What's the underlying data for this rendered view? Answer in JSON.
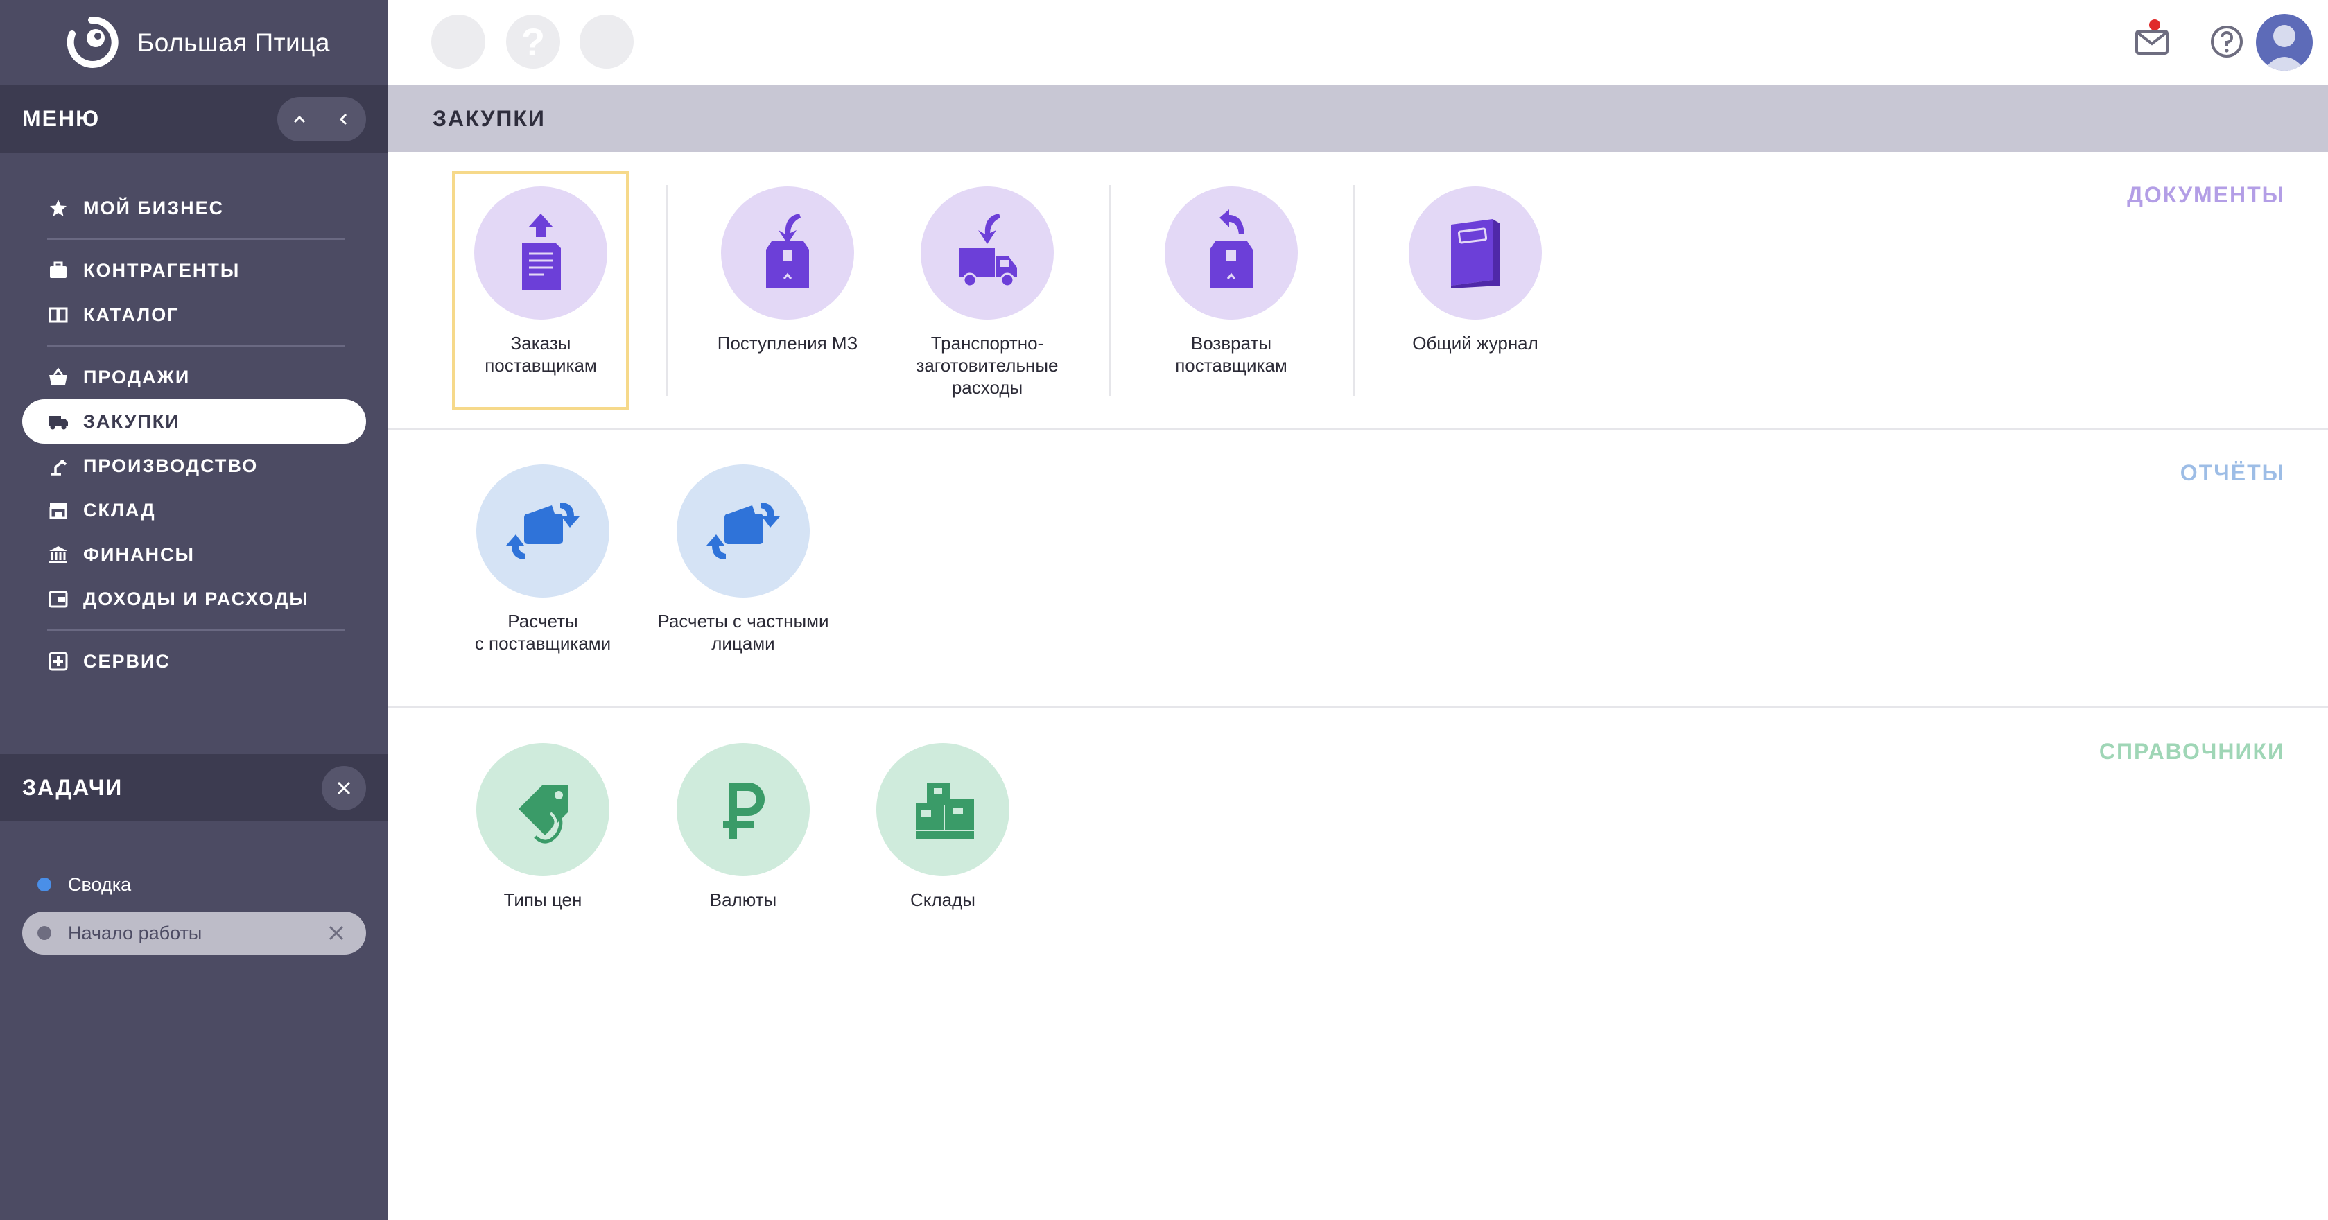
{
  "app": {
    "brand": "Большая Птица"
  },
  "sidebar": {
    "menu_title": "МЕНЮ",
    "items": [
      {
        "label": "МОЙ БИЗНЕС",
        "icon": "star-icon"
      },
      {
        "label": "КОНТРАГЕНТЫ",
        "icon": "briefcase-icon"
      },
      {
        "label": "КАТАЛОГ",
        "icon": "book-icon"
      },
      {
        "label": "ПРОДАЖИ",
        "icon": "basket-icon"
      },
      {
        "label": "ЗАКУПКИ",
        "icon": "truck-icon",
        "active": true
      },
      {
        "label": "ПРОИЗВОДСТВО",
        "icon": "robot-arm-icon"
      },
      {
        "label": "СКЛАД",
        "icon": "warehouse-icon"
      },
      {
        "label": "ФИНАНСЫ",
        "icon": "bank-icon"
      },
      {
        "label": "ДОХОДЫ И РАСХОДЫ",
        "icon": "wallet-icon"
      },
      {
        "label": "СЕРВИС",
        "icon": "service-icon"
      }
    ],
    "tasks_title": "ЗАДАЧИ",
    "tasks": [
      {
        "label": "Сводка",
        "dot_color": "#4a8fe8"
      },
      {
        "label": "Начало работы",
        "dot_color": "#6e6d80",
        "active": true
      }
    ]
  },
  "page": {
    "title": "ЗАКУПКИ"
  },
  "sections": {
    "documents": {
      "title": "ДОКУМЕНТЫ",
      "color": "#b39ee6",
      "tiles": [
        {
          "label": "Заказы\nпоставщикам",
          "icon": "order-doc-icon"
        },
        {
          "label": "Поступления МЗ",
          "icon": "incoming-box-icon"
        },
        {
          "label": "Транспортно-\nзаготовительные\nрасходы",
          "icon": "incoming-truck-icon"
        },
        {
          "label": "Возвраты\nпоставщикам",
          "icon": "return-box-icon"
        },
        {
          "label": "Общий журнал",
          "icon": "journal-icon"
        }
      ]
    },
    "reports": {
      "title": "ОТЧЁТЫ",
      "color": "#9dbde6",
      "tiles": [
        {
          "label": "Расчеты\nс поставщиками",
          "icon": "settlement-wallet-icon"
        },
        {
          "label": "Расчеты с частными\nлицами",
          "icon": "settlement-wallet-icon"
        }
      ]
    },
    "references": {
      "title": "СПРАВОЧНИКИ",
      "color": "#9fd6b6",
      "tiles": [
        {
          "label": "Типы цен",
          "icon": "price-tag-icon"
        },
        {
          "label": "Валюты",
          "icon": "ruble-icon"
        },
        {
          "label": "Склады",
          "icon": "warehouse-boxes-icon"
        }
      ]
    }
  },
  "colors": {
    "sidebar": "#4c4b63",
    "accent_purple": "#6c3fd8",
    "accent_blue": "#2f73d9",
    "accent_green": "#3a9b68",
    "selected_border": "#f6d98a"
  }
}
